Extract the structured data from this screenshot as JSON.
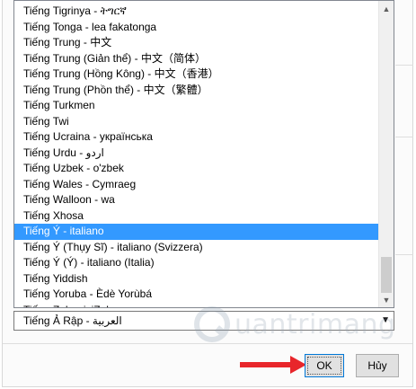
{
  "list": {
    "items": [
      "Tiếng Tigrinya - ትግርኛ",
      "Tiếng Tonga - lea fakatonga",
      "Tiếng Trung - 中文",
      "Tiếng Trung (Giản thể) - 中文（简体）",
      "Tiếng Trung (Hồng Kông) - 中文（香港）",
      "Tiếng Trung (Phồn thể) - 中文（繁體）",
      "Tiếng Turkmen",
      "Tiếng Twi",
      "Tiếng Ucraina - українська",
      "Tiếng Urdu - اردو",
      "Tiếng Uzbek - o'zbek",
      "Tiếng Wales - Cymraeg",
      "Tiếng Walloon - wa",
      "Tiếng Xhosa",
      "Tiếng Ý - italiano",
      "Tiếng Ý (Thụy Sĩ) - italiano (Svizzera)",
      "Tiếng Ý (Ý) - italiano (Italia)",
      "Tiếng Yiddish",
      "Tiếng Yoruba - Èdè Yorùbá",
      "Tiếng Zulu - isiZulu"
    ],
    "selected_index": 14
  },
  "combo": {
    "selected_value": "Tiếng Ả Rập - العربية"
  },
  "buttons": {
    "ok_label": "OK",
    "cancel_label": "Hủy"
  },
  "watermark": {
    "text": "uantrimang"
  },
  "colors": {
    "selection": "#3399ff",
    "arrow": "#e8262b"
  }
}
